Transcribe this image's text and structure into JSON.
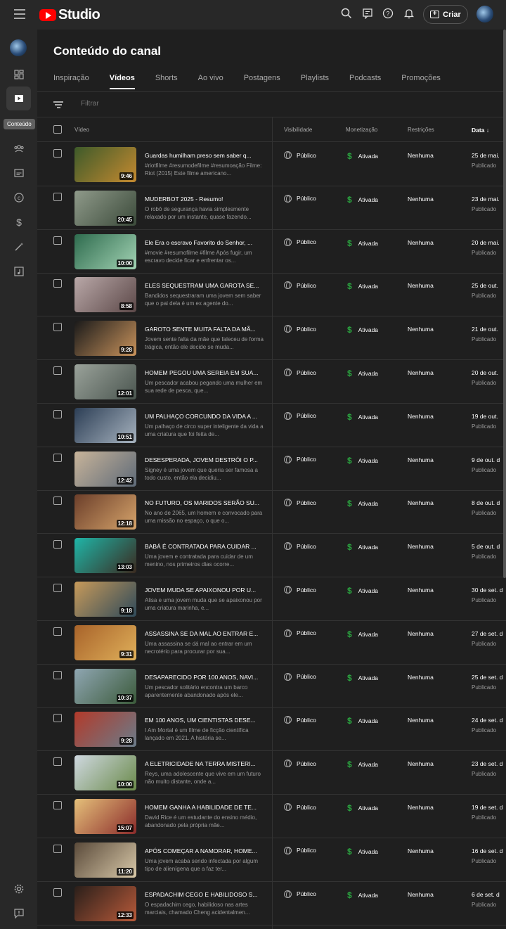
{
  "header": {
    "brand": "Studio",
    "create_label": "Criar"
  },
  "sidebar": {
    "tooltip": "Conteúdo"
  },
  "page": {
    "title": "Conteúdo do canal",
    "tabs": [
      "Inspiração",
      "Vídeos",
      "Shorts",
      "Ao vivo",
      "Postagens",
      "Playlists",
      "Podcasts",
      "Promoções"
    ],
    "active_tab": "Vídeos",
    "filter_placeholder": "Filtrar"
  },
  "table": {
    "columns": {
      "video": "Vídeo",
      "visibility": "Visibilidade",
      "monetization": "Monetização",
      "restrictions": "Restrições",
      "date": "Data"
    },
    "rows": [
      {
        "title": "Guardas humilham preso sem saber q...",
        "desc": "#riotfilme #resumodefilme #resumoação Filme: Riot (2015) Este filme americano...",
        "duration": "9:46",
        "visibility": "Público",
        "monetization": "Ativada",
        "restrictions": "Nenhuma",
        "date": "25 de mai.",
        "status": "Publicado",
        "thumb_colors": [
          "#3d5a2a",
          "#c58a30"
        ]
      },
      {
        "title": "MUDERBOT 2025 - Resumo!",
        "desc": "O robô de segurança havia simplesmente relaxado por um instante, quase fazendo...",
        "duration": "20:45",
        "visibility": "Público",
        "monetization": "Ativada",
        "restrictions": "Nenhuma",
        "date": "23 de mai.",
        "status": "Publicado",
        "thumb_colors": [
          "#8f9a8a",
          "#3b4a3a"
        ]
      },
      {
        "title": "Ele Era o escravo Favorito do Senhor, ...",
        "desc": "#movie #resumofilme #filme Após fugir, um escravo decide ficar e enfrentar os...",
        "duration": "10:00",
        "visibility": "Público",
        "monetization": "Ativada",
        "restrictions": "Nenhuma",
        "date": "20 de mai.",
        "status": "Publicado",
        "thumb_colors": [
          "#2e6b4e",
          "#a3d3b4"
        ]
      },
      {
        "title": "ELES SEQUESTRAM UMA GAROTA SE...",
        "desc": "Bandidos sequestraram uma jovem sem saber que o pai dela é um ex agente do...",
        "duration": "8:58",
        "visibility": "Público",
        "monetization": "Ativada",
        "restrictions": "Nenhuma",
        "date": "25 de out.",
        "status": "Publicado",
        "thumb_colors": [
          "#b9a8a8",
          "#5c4848"
        ]
      },
      {
        "title": "GAROTO SENTE MUITA FALTA DA MÃ...",
        "desc": "Jovem sente falta da mãe que faleceu de forma trágica, então ele decide se muda...",
        "duration": "9:28",
        "visibility": "Público",
        "monetization": "Ativada",
        "restrictions": "Nenhuma",
        "date": "21 de out.",
        "status": "Publicado",
        "thumb_colors": [
          "#1a1a1a",
          "#c9935c"
        ]
      },
      {
        "title": "HOMEM PEGOU UMA SEREIA EM SUA...",
        "desc": "Um pescador acabou pegando uma mulher em sua rede de pesca, que...",
        "duration": "12:01",
        "visibility": "Público",
        "monetization": "Ativada",
        "restrictions": "Nenhuma",
        "date": "20 de out.",
        "status": "Publicado",
        "thumb_colors": [
          "#9aa29a",
          "#4a554f"
        ]
      },
      {
        "title": "UM PALHAÇO CORCUNDO DA VIDA A ...",
        "desc": "Um palhaço de circo super inteligente da vida a uma criatura que foi feita de...",
        "duration": "10:51",
        "visibility": "Público",
        "monetization": "Ativada",
        "restrictions": "Nenhuma",
        "date": "19 de out.",
        "status": "Publicado",
        "thumb_colors": [
          "#2c3e55",
          "#a7b3bf"
        ]
      },
      {
        "title": "DESESPERADA, JOVEM DESTRÓI O P...",
        "desc": "Signey é uma jovem que queria ser famosa a todo custo, então ela decidiu...",
        "duration": "12:42",
        "visibility": "Público",
        "monetization": "Ativada",
        "restrictions": "Nenhuma",
        "date": "9 de out. d",
        "status": "Publicado",
        "thumb_colors": [
          "#c8b49a",
          "#5e6a78"
        ]
      },
      {
        "title": "NO FUTURO, OS MARIDOS SERÃO SU...",
        "desc": "No ano de 2065, um homem e convocado para uma missão no espaço, o que o...",
        "duration": "12:18",
        "visibility": "Público",
        "monetization": "Ativada",
        "restrictions": "Nenhuma",
        "date": "8 de out. d",
        "status": "Publicado",
        "thumb_colors": [
          "#6b3e2a",
          "#d6a46b"
        ]
      },
      {
        "title": "BABÁ É CONTRATADA PARA CUIDAR ...",
        "desc": "Uma jovem e contratada para cuidar de um menino, nos primeiros dias ocorre...",
        "duration": "13:03",
        "visibility": "Público",
        "monetization": "Ativada",
        "restrictions": "Nenhuma",
        "date": "5 de out. d",
        "status": "Publicado",
        "thumb_colors": [
          "#1fb5a8",
          "#3b2a1f"
        ]
      },
      {
        "title": "JOVEM MUDA SE APAIXONOU POR U...",
        "desc": "Alisa e uma jovem muda que se apaixonou por uma criatura marinha, e...",
        "duration": "9:18",
        "visibility": "Público",
        "monetization": "Ativada",
        "restrictions": "Nenhuma",
        "date": "30 de set. d",
        "status": "Publicado",
        "thumb_colors": [
          "#c79a5a",
          "#2f4a5a"
        ]
      },
      {
        "title": "ASSASSINA SE DA MAL AO ENTRAR E...",
        "desc": "Uma assassina se dá mal ao entrar em um necrotério para procurar por sua...",
        "duration": "9:31",
        "visibility": "Público",
        "monetization": "Ativada",
        "restrictions": "Nenhuma",
        "date": "27 de set. d",
        "status": "Publicado",
        "thumb_colors": [
          "#a8632a",
          "#e0b05a"
        ]
      },
      {
        "title": "DESAPARECIDO POR 100 ANOS, NAVI...",
        "desc": "Um pescador solitário encontra um barco aparentemente abandonado após ele...",
        "duration": "10:37",
        "visibility": "Público",
        "monetization": "Ativada",
        "restrictions": "Nenhuma",
        "date": "25 de set. d",
        "status": "Publicado",
        "thumb_colors": [
          "#8fa6b2",
          "#3b5a3a"
        ]
      },
      {
        "title": "EM 100 ANOS, UM CIENTISTAS DESE...",
        "desc": "I Am Mortal é um filme de ficção científica lançado em 2021. A história se...",
        "duration": "9:28",
        "visibility": "Público",
        "monetization": "Ativada",
        "restrictions": "Nenhuma",
        "date": "24 de set. d",
        "status": "Publicado",
        "thumb_colors": [
          "#b23a2a",
          "#6a7c8a"
        ]
      },
      {
        "title": "A ELETRICIDADE NA TERRA MISTERI...",
        "desc": "Reys, uma adolescente que vive em um futuro não muito distante, onde a...",
        "duration": "10:00",
        "visibility": "Público",
        "monetization": "Ativada",
        "restrictions": "Nenhuma",
        "date": "23 de set. d",
        "status": "Publicado",
        "thumb_colors": [
          "#cfd8e0",
          "#6a8a4a"
        ]
      },
      {
        "title": "HOMEM GANHA A HABILIDADE DE TE...",
        "desc": "David Rice é um estudante do ensino médio, abandonado pela própria mãe...",
        "duration": "15:07",
        "visibility": "Público",
        "monetization": "Ativada",
        "restrictions": "Nenhuma",
        "date": "19 de set. d",
        "status": "Publicado",
        "thumb_colors": [
          "#e5c07a",
          "#8a2a2a"
        ]
      },
      {
        "title": "APÓS COMEÇAR A NAMORAR, HOME...",
        "desc": "Uma jovem acaba sendo infectada por algum tipo de alienígena que a faz ter...",
        "duration": "11:20",
        "visibility": "Público",
        "monetization": "Ativada",
        "restrictions": "Nenhuma",
        "date": "16 de set. d",
        "status": "Publicado",
        "thumb_colors": [
          "#5a4a3a",
          "#d8c8a8"
        ]
      },
      {
        "title": "ESPADACHIM CEGO E HABILIDOSO S...",
        "desc": "O espadachim cego, habilidoso nas artes marciais, chamado Cheng acidentalmen...",
        "duration": "12:33",
        "visibility": "Público",
        "monetization": "Ativada",
        "restrictions": "Nenhuma",
        "date": "6 de set. d",
        "status": "Publicado",
        "thumb_colors": [
          "#2a1f1a",
          "#b85a3a"
        ]
      }
    ]
  },
  "colors": {
    "brand_red": "#ff0000",
    "monetization_green": "#2ba640"
  }
}
